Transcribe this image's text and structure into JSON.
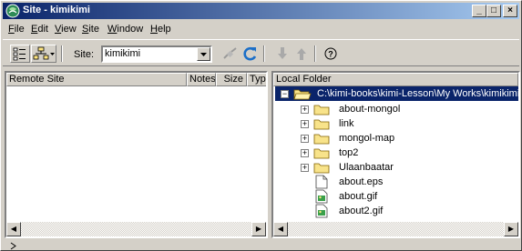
{
  "window": {
    "title": "Site - kimikimi",
    "controls": {
      "minimize": "_",
      "maximize": "□",
      "close": "×"
    }
  },
  "menu": {
    "items": [
      {
        "mnemonic": "F",
        "rest": "ile"
      },
      {
        "mnemonic": "E",
        "rest": "dit"
      },
      {
        "mnemonic": "V",
        "rest": "iew"
      },
      {
        "mnemonic": "S",
        "rest": "ite"
      },
      {
        "mnemonic": "W",
        "rest": "indow"
      },
      {
        "mnemonic": "H",
        "rest": "elp"
      }
    ]
  },
  "toolbar": {
    "site_label": "Site:",
    "site_value": "kimikimi",
    "icons": [
      "site-map-icon",
      "site-files-icon",
      "disconnect-icon",
      "refresh-icon",
      "get-icon",
      "put-icon",
      "help-icon"
    ]
  },
  "remote": {
    "columns": [
      "Remote Site",
      "Notes",
      "Size",
      "Typ"
    ]
  },
  "local": {
    "header": "Local Folder",
    "root": "C:\\kimi-books\\kimi-Lesson\\My Works\\kimikimi",
    "items": [
      {
        "name": "about-mongol",
        "type": "folder"
      },
      {
        "name": "link",
        "type": "folder"
      },
      {
        "name": "mongol-map",
        "type": "folder"
      },
      {
        "name": "top2",
        "type": "folder"
      },
      {
        "name": "Ulaanbaatar",
        "type": "folder"
      },
      {
        "name": "about.eps",
        "type": "file"
      },
      {
        "name": "about.gif",
        "type": "image"
      },
      {
        "name": "about2.gif",
        "type": "image"
      }
    ]
  },
  "colors": {
    "title_start": "#0a246a",
    "title_end": "#a6caf0",
    "selection": "#0a246a",
    "folder": "#f8e38a",
    "refresh": "#1c6fc8"
  }
}
